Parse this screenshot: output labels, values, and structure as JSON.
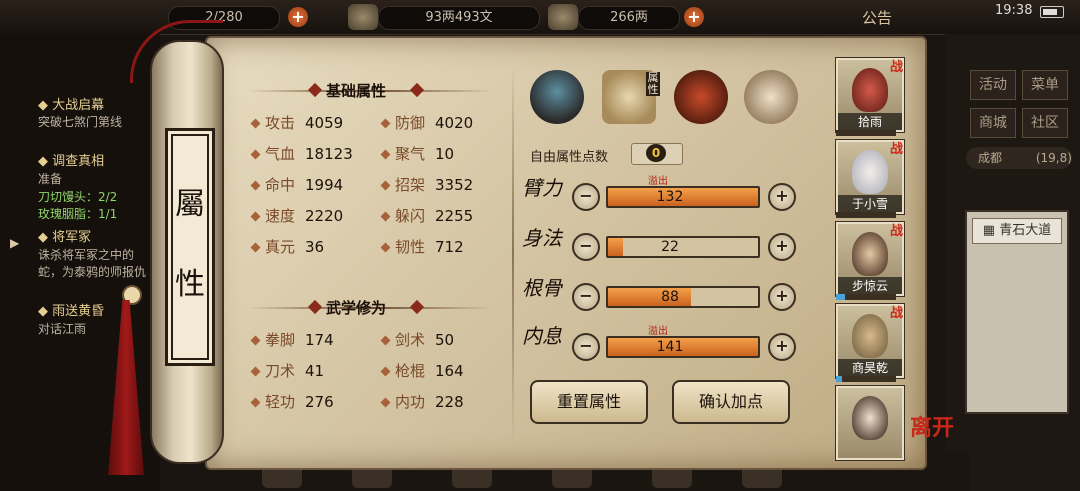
{
  "topbar": {
    "capacity_partial": "2/280",
    "silver": "93两493文",
    "gold": "266两",
    "notice": "公告",
    "clock": "19:38"
  },
  "quests": [
    {
      "title": "大战启幕",
      "desc": "突破七煞门第线"
    },
    {
      "title": "调查真相",
      "desc": "准备",
      "reqs": [
        "刀切馒头：2/2",
        "玫瑰胭脂：1/1"
      ]
    },
    {
      "title": "将军冢",
      "desc": "诛杀将军冢之中的蛇，为泰鸦的师报仇"
    },
    {
      "title": "雨送黄昏",
      "desc": "对话江雨"
    }
  ],
  "scroll": {
    "label_chars": [
      "屬",
      "性"
    ]
  },
  "basic": {
    "heading": "基础属性",
    "stats": [
      {
        "label": "攻击",
        "value": "4059"
      },
      {
        "label": "防御",
        "value": "4020"
      },
      {
        "label": "气血",
        "value": "18123"
      },
      {
        "label": "聚气",
        "value": "10"
      },
      {
        "label": "命中",
        "value": "1994"
      },
      {
        "label": "招架",
        "value": "3352"
      },
      {
        "label": "速度",
        "value": "2220"
      },
      {
        "label": "躲闪",
        "value": "2255"
      },
      {
        "label": "真元",
        "value": "36"
      },
      {
        "label": "韧性",
        "value": "712"
      }
    ]
  },
  "martial": {
    "heading": "武学修为",
    "stats": [
      {
        "label": "拳脚",
        "value": "174"
      },
      {
        "label": "剑术",
        "value": "50"
      },
      {
        "label": "刀术",
        "value": "41"
      },
      {
        "label": "枪棍",
        "value": "164"
      },
      {
        "label": "轻功",
        "value": "276"
      },
      {
        "label": "内功",
        "value": "228"
      }
    ]
  },
  "tabs": {
    "attr_tab_label": "属性"
  },
  "points": {
    "free_label": "自由属性点数",
    "free_value": "0",
    "overflow_label": "溢出",
    "attrs": [
      {
        "label": "臂力",
        "value": "132",
        "fill": 1.0,
        "overflow": true
      },
      {
        "label": "身法",
        "value": "22",
        "fill": 0.1,
        "overflow": false
      },
      {
        "label": "根骨",
        "value": "88",
        "fill": 0.55,
        "overflow": false
      },
      {
        "label": "内息",
        "value": "141",
        "fill": 1.0,
        "overflow": true
      }
    ],
    "reset_label": "重置属性",
    "confirm_label": "确认加点"
  },
  "party": {
    "badge": "战",
    "members": [
      {
        "name": "拾雨",
        "hp": 0.0
      },
      {
        "name": "于小雪",
        "hp": 0.0
      },
      {
        "name": "步惊云",
        "hp": 0.15
      },
      {
        "name": "商昊乾",
        "hp": 0.1
      },
      {
        "name": "",
        "hp": 0.0
      }
    ],
    "leave_label": "离开"
  },
  "rightpanel": {
    "buttons": [
      "活动",
      "菜单",
      "商城",
      "社区"
    ],
    "city": "成都",
    "coords": "(19,8)",
    "location": "青石大道"
  },
  "colors": {
    "accent": "#c9621e",
    "overflow": "#b32315",
    "battle": "#d02a18"
  }
}
